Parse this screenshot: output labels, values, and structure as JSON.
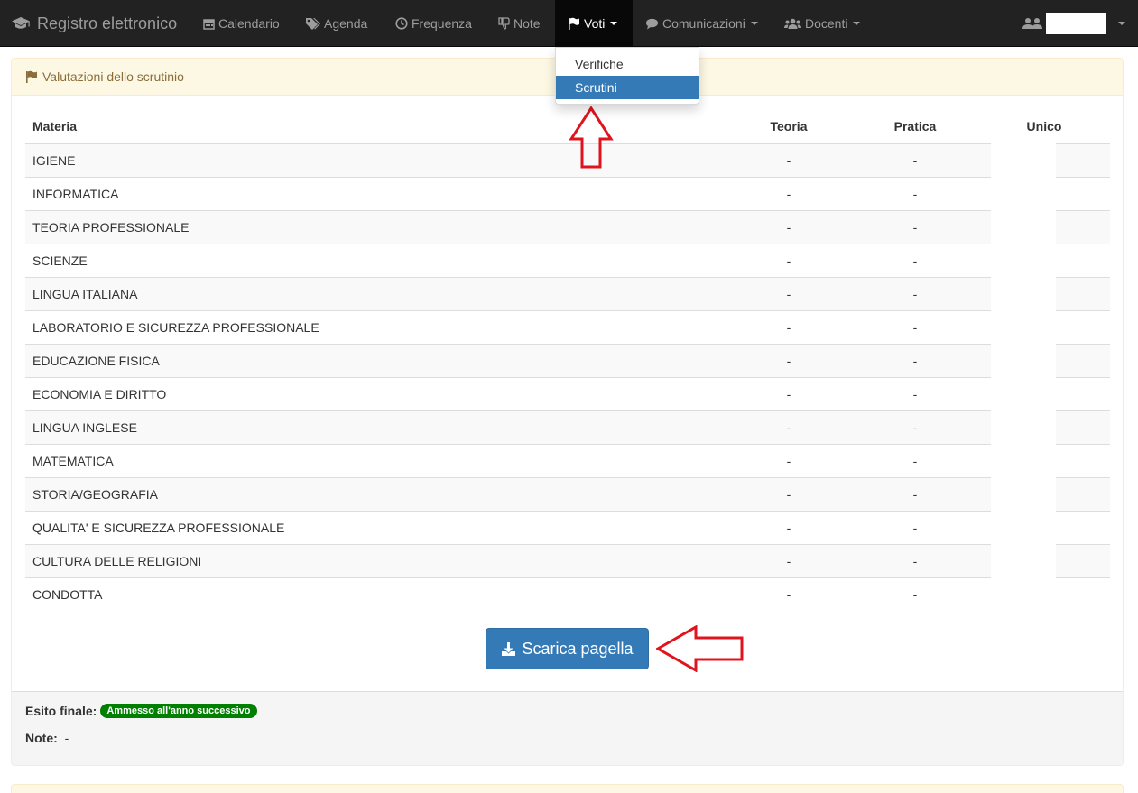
{
  "navbar": {
    "brand": "Registro elettronico",
    "items": [
      {
        "label": "Calendario",
        "icon": "calendar-icon"
      },
      {
        "label": "Agenda",
        "icon": "tags-icon"
      },
      {
        "label": "Frequenza",
        "icon": "clock-icon"
      },
      {
        "label": "Note",
        "icon": "thumbs-down-icon"
      },
      {
        "label": "Voti",
        "icon": "flag-icon",
        "active": true
      },
      {
        "label": "Comunicazioni",
        "icon": "comment-icon"
      },
      {
        "label": "Docenti",
        "icon": "users-icon"
      }
    ]
  },
  "dropdown": {
    "items": [
      {
        "label": "Verifiche",
        "active": false
      },
      {
        "label": "Scrutini",
        "active": true
      }
    ]
  },
  "panel": {
    "title": "Valutazioni dello scrutinio",
    "columns": {
      "materia": "Materia",
      "teoria": "Teoria",
      "pratica": "Pratica",
      "unico": "Unico"
    },
    "rows": [
      {
        "materia": "IGIENE",
        "teoria": "-",
        "pratica": "-"
      },
      {
        "materia": "INFORMATICA",
        "teoria": "-",
        "pratica": "-"
      },
      {
        "materia": "TEORIA PROFESSIONALE",
        "teoria": "-",
        "pratica": "-"
      },
      {
        "materia": "SCIENZE",
        "teoria": "-",
        "pratica": "-"
      },
      {
        "materia": "LINGUA ITALIANA",
        "teoria": "-",
        "pratica": "-"
      },
      {
        "materia": "LABORATORIO E SICUREZZA PROFESSIONALE",
        "teoria": "-",
        "pratica": "-"
      },
      {
        "materia": "EDUCAZIONE FISICA",
        "teoria": "-",
        "pratica": "-"
      },
      {
        "materia": "ECONOMIA E DIRITTO",
        "teoria": "-",
        "pratica": "-"
      },
      {
        "materia": "LINGUA INGLESE",
        "teoria": "-",
        "pratica": "-"
      },
      {
        "materia": "MATEMATICA",
        "teoria": "-",
        "pratica": "-"
      },
      {
        "materia": "STORIA/GEOGRAFIA",
        "teoria": "-",
        "pratica": "-"
      },
      {
        "materia": "QUALITA' E SICUREZZA PROFESSIONALE",
        "teoria": "-",
        "pratica": "-"
      },
      {
        "materia": "CULTURA DELLE RELIGIONI",
        "teoria": "-",
        "pratica": "-"
      },
      {
        "materia": "CONDOTTA",
        "teoria": "-",
        "pratica": "-"
      }
    ],
    "download_label": "Scarica pagella",
    "footer": {
      "esito_label": "Esito finale:",
      "esito_value": "Ammesso all'anno successivo",
      "note_label": "Note:",
      "note_value": "-"
    }
  },
  "colors": {
    "navbar_bg": "#222222",
    "primary": "#337ab7",
    "warning_bg": "#fcf8e3",
    "warning_text": "#8a6d3b",
    "success_badge": "#008000",
    "annotation_red": "#e0141e"
  }
}
